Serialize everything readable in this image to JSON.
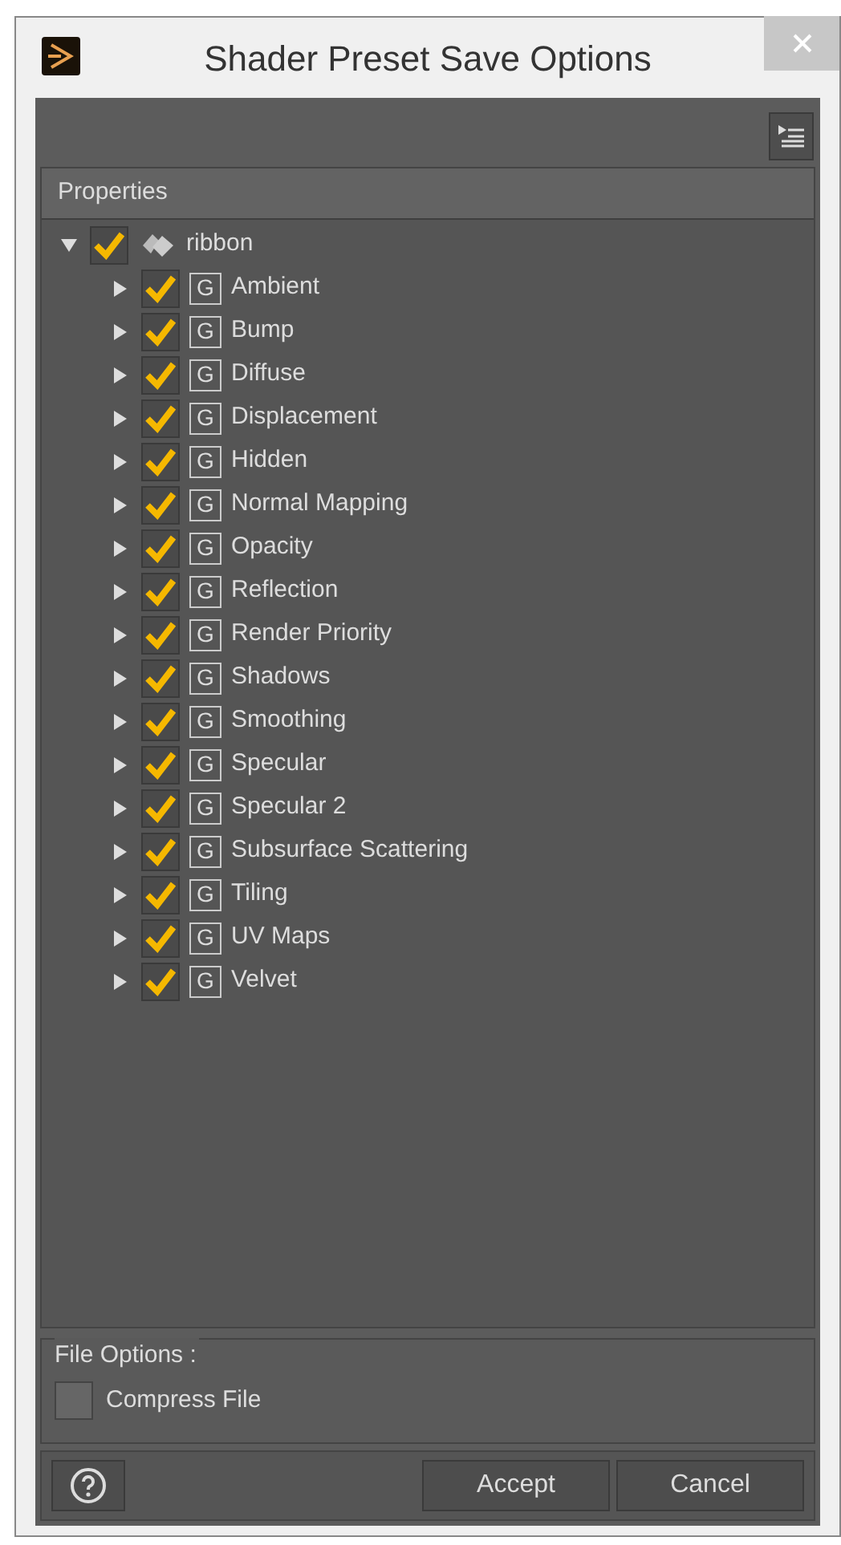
{
  "window": {
    "title": "Shader Preset Save Options"
  },
  "properties": {
    "header": "Properties",
    "tree": [
      {
        "label": "ribbon",
        "expanded": true,
        "checked": true,
        "children": [
          {
            "label": "Ambient",
            "badge": "G",
            "expanded": false,
            "checked": true
          },
          {
            "label": "Bump",
            "badge": "G",
            "expanded": false,
            "checked": true
          },
          {
            "label": "Diffuse",
            "badge": "G",
            "expanded": false,
            "checked": true
          },
          {
            "label": "Displacement",
            "badge": "G",
            "expanded": false,
            "checked": true
          },
          {
            "label": "Hidden",
            "badge": "G",
            "expanded": false,
            "checked": true
          },
          {
            "label": "Normal Mapping",
            "badge": "G",
            "expanded": false,
            "checked": true
          },
          {
            "label": "Opacity",
            "badge": "G",
            "expanded": false,
            "checked": true
          },
          {
            "label": "Reflection",
            "badge": "G",
            "expanded": false,
            "checked": true
          },
          {
            "label": "Render Priority",
            "badge": "G",
            "expanded": false,
            "checked": true
          },
          {
            "label": "Shadows",
            "badge": "G",
            "expanded": false,
            "checked": true
          },
          {
            "label": "Smoothing",
            "badge": "G",
            "expanded": false,
            "checked": true
          },
          {
            "label": "Specular",
            "badge": "G",
            "expanded": false,
            "checked": true
          },
          {
            "label": "Specular 2",
            "badge": "G",
            "expanded": false,
            "checked": true
          },
          {
            "label": "Subsurface Scattering",
            "badge": "G",
            "expanded": false,
            "checked": true
          },
          {
            "label": "Tiling",
            "badge": "G",
            "expanded": false,
            "checked": true
          },
          {
            "label": "UV Maps",
            "badge": "G",
            "expanded": false,
            "checked": true
          },
          {
            "label": "Velvet",
            "badge": "G",
            "expanded": false,
            "checked": true
          }
        ]
      }
    ]
  },
  "file_options": {
    "title": "File Options :",
    "compress_file": {
      "label": "Compress File",
      "checked": false
    }
  },
  "buttons": [
    "Accept",
    "Cancel"
  ]
}
